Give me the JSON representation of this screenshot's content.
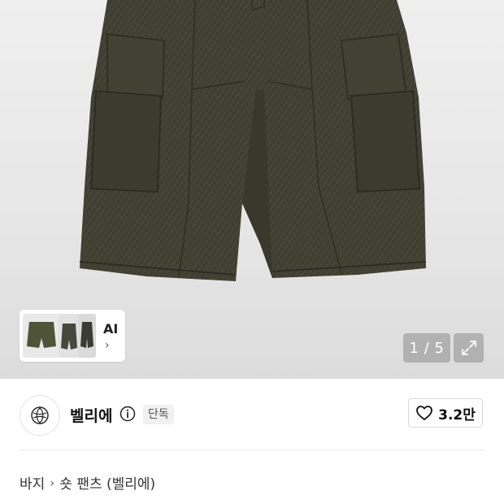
{
  "gallery": {
    "counter": "1 / 5",
    "ai_label": "AI",
    "ai_chevron": "›"
  },
  "brand": {
    "name": "벨리에",
    "badge": "단독"
  },
  "like": {
    "count": "3.2만"
  },
  "breadcrumb": {
    "category": "바지",
    "separator": "›",
    "subcategory": "숏 팬츠 (벨리에)"
  },
  "colors": {
    "product": "#3d3d30",
    "badge_bg": "#f1f1f1"
  },
  "icons": {
    "expand": "expand-icon",
    "info": "info-icon",
    "heart": "heart-icon",
    "brand_logo": "brand-logo-icon"
  }
}
